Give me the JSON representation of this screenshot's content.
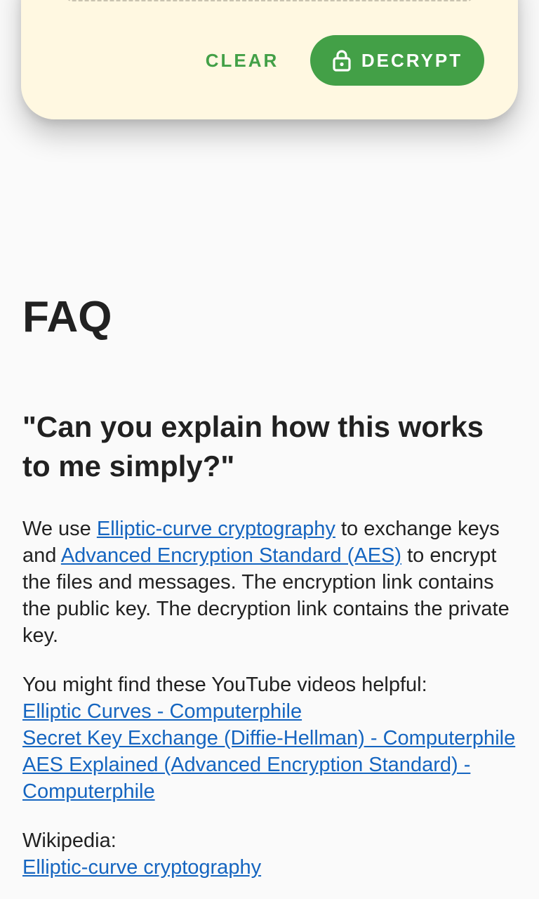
{
  "card": {
    "clear_label": "CLEAR",
    "decrypt_label": "DECRYPT",
    "decrypt_icon": "lock-icon",
    "accent_color": "#43a047",
    "background_color": "#fff8e1"
  },
  "faq": {
    "title": "FAQ",
    "question": "\"Can you explain how this works to me simply?\"",
    "para1": {
      "t1": "We use ",
      "link1": "Elliptic-curve cryptography",
      "t2": " to exchange keys and ",
      "link2": "Advanced Encryption Standard (AES)",
      "t3": " to encrypt the files and messages. The encryption link contains the public key. The decryption link contains the private key."
    },
    "videos": {
      "intro": "You might find these YouTube videos helpful:",
      "links": [
        "Elliptic Curves - Computerphile",
        "Secret Key Exchange (Diffie-Hellman) - Computerphile",
        "AES Explained (Advanced Encryption Standard) - Computerphile"
      ]
    },
    "wikipedia": {
      "intro": "Wikipedia:",
      "links": [
        "Elliptic-curve cryptography"
      ]
    },
    "link_color": "#1565c0"
  }
}
